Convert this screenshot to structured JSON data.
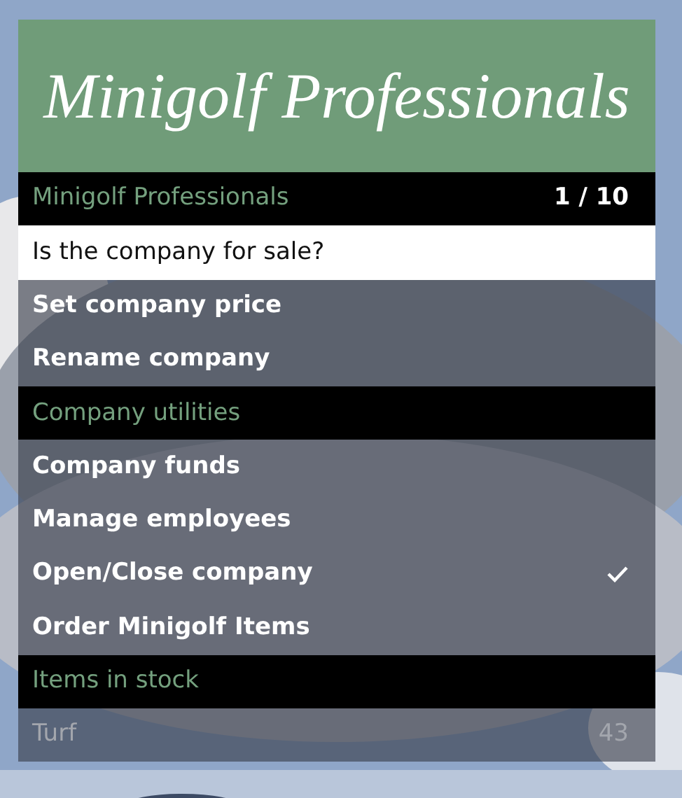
{
  "menu": {
    "banner_title": "Minigolf Professionals",
    "rows": [
      {
        "kind": "header",
        "label": "Minigolf Professionals",
        "counter": "1 / 10"
      },
      {
        "kind": "item",
        "label": "Is the company for sale?",
        "selected": true,
        "checked": false,
        "disabled": false
      },
      {
        "kind": "item",
        "label": "Set company price",
        "selected": false,
        "checked": false,
        "disabled": false
      },
      {
        "kind": "item",
        "label": "Rename company",
        "selected": false,
        "checked": false,
        "disabled": false
      },
      {
        "kind": "header",
        "label": "Company utilities"
      },
      {
        "kind": "item",
        "label": "Company funds",
        "selected": false,
        "checked": false,
        "disabled": false
      },
      {
        "kind": "item",
        "label": "Manage employees",
        "selected": false,
        "checked": false,
        "disabled": false
      },
      {
        "kind": "item",
        "label": "Open/Close company",
        "selected": false,
        "checked": true,
        "disabled": false
      },
      {
        "kind": "item",
        "label": "Order Minigolf Items",
        "selected": false,
        "checked": false,
        "disabled": false
      },
      {
        "kind": "header",
        "label": "Items in stock"
      },
      {
        "kind": "item",
        "label": "Turf",
        "value": "43",
        "selected": false,
        "checked": false,
        "disabled": true
      }
    ]
  }
}
